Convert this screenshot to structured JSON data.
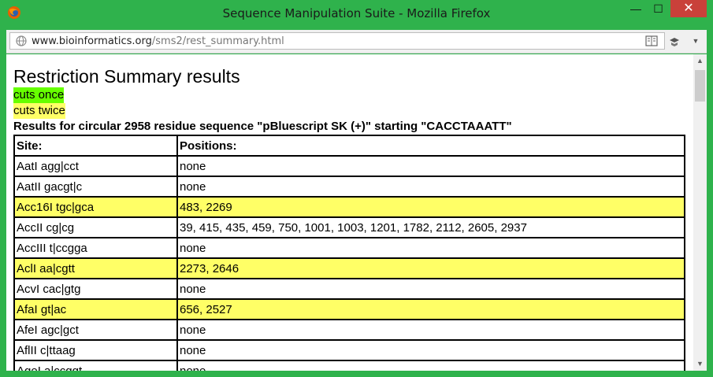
{
  "window": {
    "title": "Sequence Manipulation Suite - Mozilla Firefox",
    "minimize": "—",
    "maximize": "☐",
    "close": "✕"
  },
  "urlbar": {
    "domain": "www.bioinformatics.org",
    "path": "/sms2/rest_summary.html"
  },
  "page": {
    "title": "Restriction Summary results",
    "legend_once": "cuts once",
    "legend_twice": "cuts twice",
    "results_heading": "Results for circular 2958 residue sequence \"pBluescript SK (+)\" starting \"CACCTAAATT\"",
    "col_site": "Site:",
    "col_positions": "Positions:",
    "rows": [
      {
        "site": "AatI agg|cct",
        "positions": "none"
      },
      {
        "site": "AatII gacgt|c",
        "positions": "none"
      },
      {
        "site": "Acc16I tgc|gca",
        "positions": "483, 2269"
      },
      {
        "site": "AccII cg|cg",
        "positions": "39, 415, 435, 459, 750, 1001, 1003, 1201, 1782, 2112, 2605, 2937"
      },
      {
        "site": "AccIII t|ccgga",
        "positions": "none"
      },
      {
        "site": "AclI aa|cgtt",
        "positions": "2273, 2646"
      },
      {
        "site": "AcvI cac|gtg",
        "positions": "none"
      },
      {
        "site": "AfaI gt|ac",
        "positions": "656, 2527"
      },
      {
        "site": "AfeI agc|gct",
        "positions": "none"
      },
      {
        "site": "AflII c|ttaag",
        "positions": "none"
      },
      {
        "site": "AgeI a|ccggt",
        "positions": "none"
      }
    ]
  },
  "colors": {
    "cuts_once": "#66ff00",
    "cuts_twice": "#ffff66",
    "window_frame": "#2fb24c"
  }
}
